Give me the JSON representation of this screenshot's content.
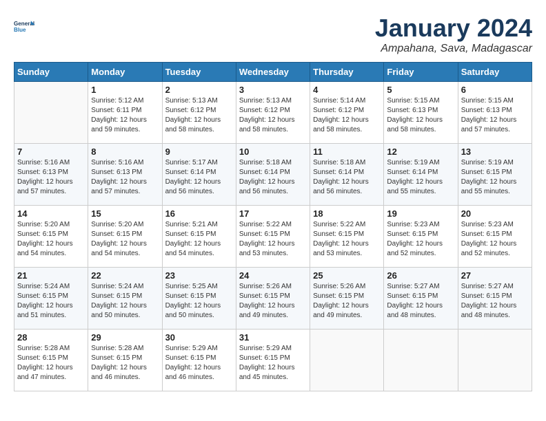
{
  "header": {
    "logo_line1": "General",
    "logo_line2": "Blue",
    "month": "January 2024",
    "location": "Ampahana, Sava, Madagascar"
  },
  "days_of_week": [
    "Sunday",
    "Monday",
    "Tuesday",
    "Wednesday",
    "Thursday",
    "Friday",
    "Saturday"
  ],
  "weeks": [
    [
      {
        "day": "",
        "info": ""
      },
      {
        "day": "1",
        "info": "Sunrise: 5:12 AM\nSunset: 6:11 PM\nDaylight: 12 hours\nand 59 minutes."
      },
      {
        "day": "2",
        "info": "Sunrise: 5:13 AM\nSunset: 6:12 PM\nDaylight: 12 hours\nand 58 minutes."
      },
      {
        "day": "3",
        "info": "Sunrise: 5:13 AM\nSunset: 6:12 PM\nDaylight: 12 hours\nand 58 minutes."
      },
      {
        "day": "4",
        "info": "Sunrise: 5:14 AM\nSunset: 6:12 PM\nDaylight: 12 hours\nand 58 minutes."
      },
      {
        "day": "5",
        "info": "Sunrise: 5:15 AM\nSunset: 6:13 PM\nDaylight: 12 hours\nand 58 minutes."
      },
      {
        "day": "6",
        "info": "Sunrise: 5:15 AM\nSunset: 6:13 PM\nDaylight: 12 hours\nand 57 minutes."
      }
    ],
    [
      {
        "day": "7",
        "info": "Sunrise: 5:16 AM\nSunset: 6:13 PM\nDaylight: 12 hours\nand 57 minutes."
      },
      {
        "day": "8",
        "info": "Sunrise: 5:16 AM\nSunset: 6:13 PM\nDaylight: 12 hours\nand 57 minutes."
      },
      {
        "day": "9",
        "info": "Sunrise: 5:17 AM\nSunset: 6:14 PM\nDaylight: 12 hours\nand 56 minutes."
      },
      {
        "day": "10",
        "info": "Sunrise: 5:18 AM\nSunset: 6:14 PM\nDaylight: 12 hours\nand 56 minutes."
      },
      {
        "day": "11",
        "info": "Sunrise: 5:18 AM\nSunset: 6:14 PM\nDaylight: 12 hours\nand 56 minutes."
      },
      {
        "day": "12",
        "info": "Sunrise: 5:19 AM\nSunset: 6:14 PM\nDaylight: 12 hours\nand 55 minutes."
      },
      {
        "day": "13",
        "info": "Sunrise: 5:19 AM\nSunset: 6:15 PM\nDaylight: 12 hours\nand 55 minutes."
      }
    ],
    [
      {
        "day": "14",
        "info": "Sunrise: 5:20 AM\nSunset: 6:15 PM\nDaylight: 12 hours\nand 54 minutes."
      },
      {
        "day": "15",
        "info": "Sunrise: 5:20 AM\nSunset: 6:15 PM\nDaylight: 12 hours\nand 54 minutes."
      },
      {
        "day": "16",
        "info": "Sunrise: 5:21 AM\nSunset: 6:15 PM\nDaylight: 12 hours\nand 54 minutes."
      },
      {
        "day": "17",
        "info": "Sunrise: 5:22 AM\nSunset: 6:15 PM\nDaylight: 12 hours\nand 53 minutes."
      },
      {
        "day": "18",
        "info": "Sunrise: 5:22 AM\nSunset: 6:15 PM\nDaylight: 12 hours\nand 53 minutes."
      },
      {
        "day": "19",
        "info": "Sunrise: 5:23 AM\nSunset: 6:15 PM\nDaylight: 12 hours\nand 52 minutes."
      },
      {
        "day": "20",
        "info": "Sunrise: 5:23 AM\nSunset: 6:15 PM\nDaylight: 12 hours\nand 52 minutes."
      }
    ],
    [
      {
        "day": "21",
        "info": "Sunrise: 5:24 AM\nSunset: 6:15 PM\nDaylight: 12 hours\nand 51 minutes."
      },
      {
        "day": "22",
        "info": "Sunrise: 5:24 AM\nSunset: 6:15 PM\nDaylight: 12 hours\nand 50 minutes."
      },
      {
        "day": "23",
        "info": "Sunrise: 5:25 AM\nSunset: 6:15 PM\nDaylight: 12 hours\nand 50 minutes."
      },
      {
        "day": "24",
        "info": "Sunrise: 5:26 AM\nSunset: 6:15 PM\nDaylight: 12 hours\nand 49 minutes."
      },
      {
        "day": "25",
        "info": "Sunrise: 5:26 AM\nSunset: 6:15 PM\nDaylight: 12 hours\nand 49 minutes."
      },
      {
        "day": "26",
        "info": "Sunrise: 5:27 AM\nSunset: 6:15 PM\nDaylight: 12 hours\nand 48 minutes."
      },
      {
        "day": "27",
        "info": "Sunrise: 5:27 AM\nSunset: 6:15 PM\nDaylight: 12 hours\nand 48 minutes."
      }
    ],
    [
      {
        "day": "28",
        "info": "Sunrise: 5:28 AM\nSunset: 6:15 PM\nDaylight: 12 hours\nand 47 minutes."
      },
      {
        "day": "29",
        "info": "Sunrise: 5:28 AM\nSunset: 6:15 PM\nDaylight: 12 hours\nand 46 minutes."
      },
      {
        "day": "30",
        "info": "Sunrise: 5:29 AM\nSunset: 6:15 PM\nDaylight: 12 hours\nand 46 minutes."
      },
      {
        "day": "31",
        "info": "Sunrise: 5:29 AM\nSunset: 6:15 PM\nDaylight: 12 hours\nand 45 minutes."
      },
      {
        "day": "",
        "info": ""
      },
      {
        "day": "",
        "info": ""
      },
      {
        "day": "",
        "info": ""
      }
    ]
  ]
}
